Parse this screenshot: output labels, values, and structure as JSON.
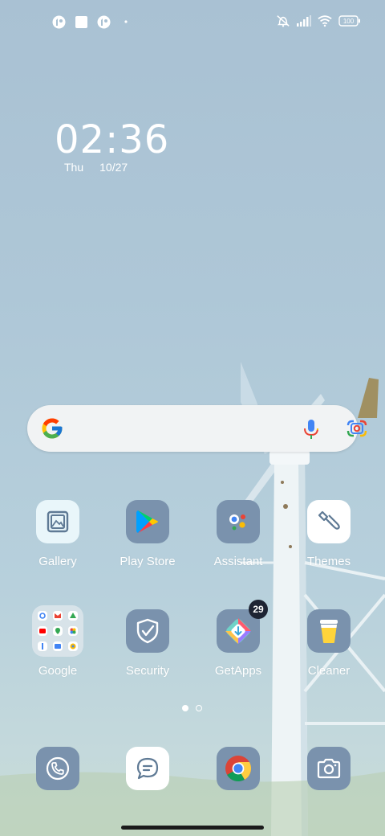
{
  "status_bar": {
    "left_icons": [
      "notification-app-icon",
      "notification-square-icon",
      "notification-app-icon",
      "more-notifications-dot"
    ],
    "right_icons": [
      "vibrate-silent-icon",
      "signal-icon",
      "wifi-icon",
      "battery-icon"
    ],
    "battery_level": "100"
  },
  "clock": {
    "time": "02:36",
    "day": "Thu",
    "date": "10/27"
  },
  "search_bar": {
    "logo": "google-g-icon",
    "mic": "mic-icon",
    "lens": "lens-icon"
  },
  "apps_row1": [
    {
      "label": "Gallery",
      "icon": "gallery-icon"
    },
    {
      "label": "Play Store",
      "icon": "play-store-icon"
    },
    {
      "label": "Assistant",
      "icon": "assistant-icon"
    },
    {
      "label": "Themes",
      "icon": "themes-icon"
    }
  ],
  "apps_row2": [
    {
      "label": "Google",
      "icon": "folder-icon"
    },
    {
      "label": "Security",
      "icon": "security-icon"
    },
    {
      "label": "GetApps",
      "icon": "getapps-icon",
      "badge": "29"
    },
    {
      "label": "Cleaner",
      "icon": "cleaner-icon"
    }
  ],
  "page_indicator": {
    "pages": 2,
    "current": 1
  },
  "dock": [
    {
      "icon": "phone-icon"
    },
    {
      "icon": "messages-icon"
    },
    {
      "icon": "chrome-icon"
    },
    {
      "icon": "camera-icon"
    }
  ],
  "colors": {
    "tile": "#7a92ad",
    "wallpaper_top": "#a9c1d3",
    "badge": "#1e2433"
  }
}
